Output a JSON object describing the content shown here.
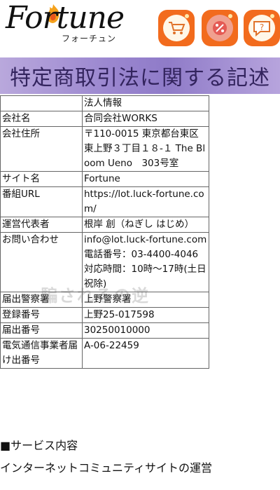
{
  "header": {
    "logo_text": "Fortune",
    "logo_subtitle": "フォーチュン",
    "icons": [
      "cart-icon",
      "coupon-icon",
      "help-icon"
    ]
  },
  "banner": {
    "title": "特定商取引法に関する記述"
  },
  "table": {
    "header": "法人情報",
    "rows": [
      {
        "label": "会社名",
        "value": "合同会社WORKS"
      },
      {
        "label": "会社住所",
        "value": "〒110-0015 東京都台東区東上野３丁目１８-１ The Bloom Ueno　303号室"
      },
      {
        "label": "サイト名",
        "value": "Fortune"
      },
      {
        "label": "番組URL",
        "value": "https://lot.luck-fortune.com/"
      },
      {
        "label": "運営代表者",
        "value": "根岸 創（ねぎし はじめ）"
      },
      {
        "label": "お問い合わせ",
        "value": "info@lot.luck-fortune.com 電話番号：03-4400-4046 対応時間：10時～17時(土日祝除)"
      },
      {
        "label": "届出警察署",
        "value": "上野警察署"
      },
      {
        "label": "登録番号",
        "value": "上野25-017598"
      },
      {
        "label": "届出番号",
        "value": "30250010000"
      },
      {
        "label": "電気通信事業者届け出番号",
        "value": "A-06-22459"
      }
    ]
  },
  "watermark": {
    "text": "騙されるの逆"
  },
  "service": {
    "title": "■サービス内容",
    "body": "インターネットコミュニティサイトの運営"
  },
  "colors": {
    "accent": "#f26b1d",
    "banner": "#9a86cf"
  }
}
